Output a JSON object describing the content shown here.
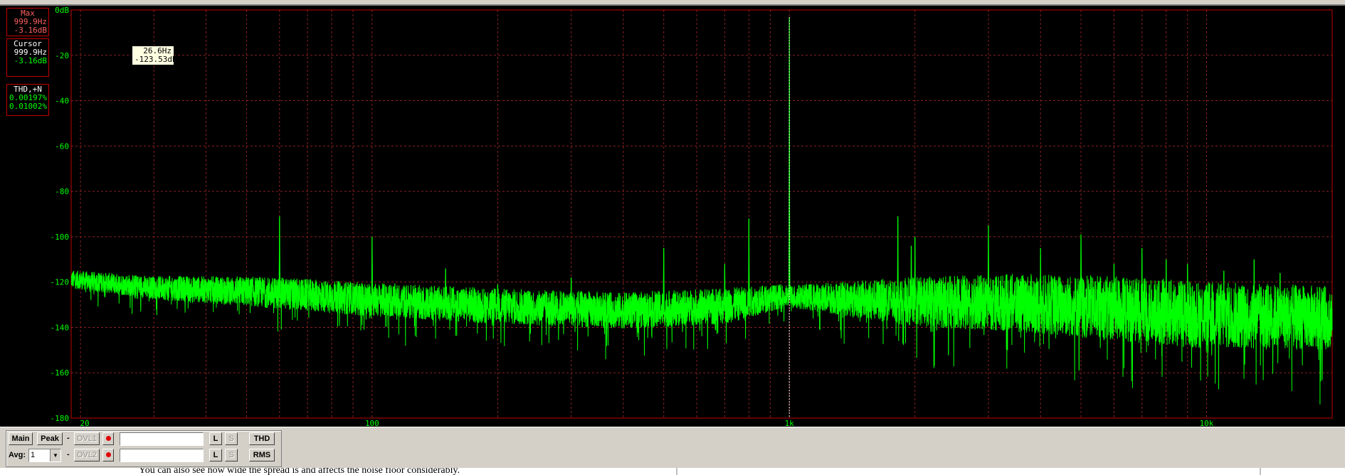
{
  "chart_data": {
    "type": "line",
    "xlabel": "",
    "ylabel": "",
    "x_scale": "log",
    "xlim": [
      19.0,
      20000
    ],
    "ylim": [
      -180,
      0
    ],
    "x_ticks": [
      20,
      100,
      1000,
      10000
    ],
    "x_tick_labels": [
      "20",
      "100",
      "1k",
      "10k"
    ],
    "y_ticks": [
      0,
      -20,
      -40,
      -60,
      -80,
      -100,
      -120,
      -140,
      -160,
      -180
    ],
    "y_tick_labels": [
      "0dB",
      "-20",
      "-40",
      "-60",
      "-80",
      "-100",
      "-120",
      "-140",
      "-160",
      "-180"
    ],
    "grid": true,
    "series": [
      {
        "color": "#00ff00",
        "noise_floor": [
          [
            19,
            -120
          ],
          [
            30,
            -124
          ],
          [
            50,
            -126
          ],
          [
            100,
            -130
          ],
          [
            200,
            -133
          ],
          [
            400,
            -135
          ],
          [
            700,
            -133
          ],
          [
            950,
            -128
          ],
          [
            1050,
            -128
          ],
          [
            2000,
            -132
          ],
          [
            3500,
            -133
          ],
          [
            6000,
            -136
          ],
          [
            10000,
            -139
          ],
          [
            20000,
            -140
          ]
        ],
        "noise_spread_db": [
          [
            19,
            8
          ],
          [
            60,
            14
          ],
          [
            200,
            16
          ],
          [
            700,
            16
          ],
          [
            1000,
            10
          ],
          [
            2000,
            22
          ],
          [
            5000,
            28
          ],
          [
            10000,
            30
          ],
          [
            20000,
            28
          ]
        ],
        "peaks": [
          {
            "x": 999.9,
            "y": -3.16
          },
          {
            "x": 60,
            "y": -91
          },
          {
            "x": 100,
            "y": -100
          },
          {
            "x": 150,
            "y": -114
          },
          {
            "x": 200,
            "y": -121
          },
          {
            "x": 300,
            "y": -118
          },
          {
            "x": 500,
            "y": -105
          },
          {
            "x": 700,
            "y": -112
          },
          {
            "x": 800,
            "y": -92
          },
          {
            "x": 1000,
            "y": -40
          },
          {
            "x": 1960,
            "y": -104
          },
          {
            "x": 1820,
            "y": -91
          },
          {
            "x": 2000,
            "y": -100
          },
          {
            "x": 3000,
            "y": -95
          },
          {
            "x": 4000,
            "y": -105
          },
          {
            "x": 5000,
            "y": -99
          },
          {
            "x": 6000,
            "y": -112
          },
          {
            "x": 7000,
            "y": -105
          },
          {
            "x": 8000,
            "y": -110
          },
          {
            "x": 9000,
            "y": -112
          },
          {
            "x": 11000,
            "y": -115
          },
          {
            "x": 13000,
            "y": -110
          },
          {
            "x": 15000,
            "y": -116
          }
        ]
      }
    ],
    "cursor_x": 999.9
  },
  "readouts": {
    "max": {
      "title": "Max",
      "freq": "999.9Hz",
      "level": "-3.16dB"
    },
    "cursor": {
      "title": "Cursor",
      "freq": "999.9Hz",
      "level": "-3.16dB"
    },
    "thd": {
      "title": "THD,+N",
      "thd": "0.00197%",
      "thdn": "0.01002%"
    },
    "tooltip": {
      "freq": "26.6Hz",
      "level": "-123.53dB"
    }
  },
  "controls": {
    "main_label": "Main",
    "peak_label": "Peak",
    "dash": "-",
    "ovl1_label": "OVL1",
    "ovl2_label": "OVL2",
    "avg_label": "Avg:",
    "avg_value": "1",
    "l_label": "L",
    "s_label": "S",
    "thd_label": "THD",
    "rms_label": "RMS"
  },
  "below_text": "You can also see how wide the spread is and affects the noise floor considerably."
}
